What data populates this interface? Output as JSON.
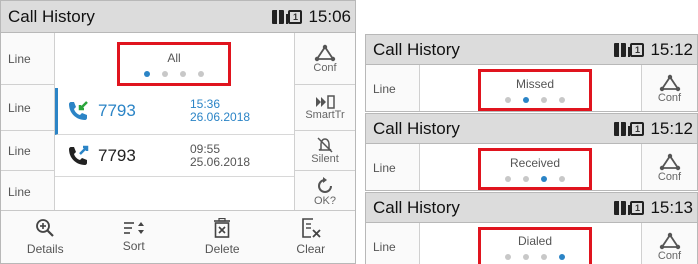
{
  "main": {
    "title": "Call History",
    "time": "15:06",
    "filter_label": "All",
    "line_label": "Line",
    "right_buttons": [
      "Conf",
      "SmartTr",
      "Silent",
      "OK?"
    ],
    "rows": [
      {
        "number": "7793",
        "time": "15:36",
        "date": "26.06.2018",
        "type": "missed",
        "selected": true
      },
      {
        "number": "7793",
        "time": "09:55",
        "date": "25.06.2018",
        "type": "dialed",
        "selected": false
      }
    ],
    "bottom_buttons": [
      "Details",
      "Sort",
      "Delete",
      "Clear"
    ]
  },
  "panels": [
    {
      "title": "Call History",
      "time": "15:12",
      "line_label": "Line",
      "filter_label": "Missed",
      "active_dot": 1,
      "right_label": "Conf"
    },
    {
      "title": "Call History",
      "time": "15:12",
      "line_label": "Line",
      "filter_label": "Received",
      "active_dot": 2,
      "right_label": "Conf"
    },
    {
      "title": "Call History",
      "time": "15:13",
      "line_label": "Line",
      "filter_label": "Dialed",
      "active_dot": 3,
      "right_label": "Conf"
    }
  ],
  "colors": {
    "accent": "#2b84c6",
    "highlight": "#e0141e",
    "titlebar": "#dcdcdc"
  },
  "icons": [
    "phonebook-icon",
    "line-one-icon",
    "conference-icon",
    "smart-transfer-icon",
    "silent-icon",
    "refresh-icon",
    "missed-call-icon",
    "dialed-call-icon",
    "zoom-details-icon",
    "sort-icon",
    "delete-icon",
    "clear-icon"
  ]
}
